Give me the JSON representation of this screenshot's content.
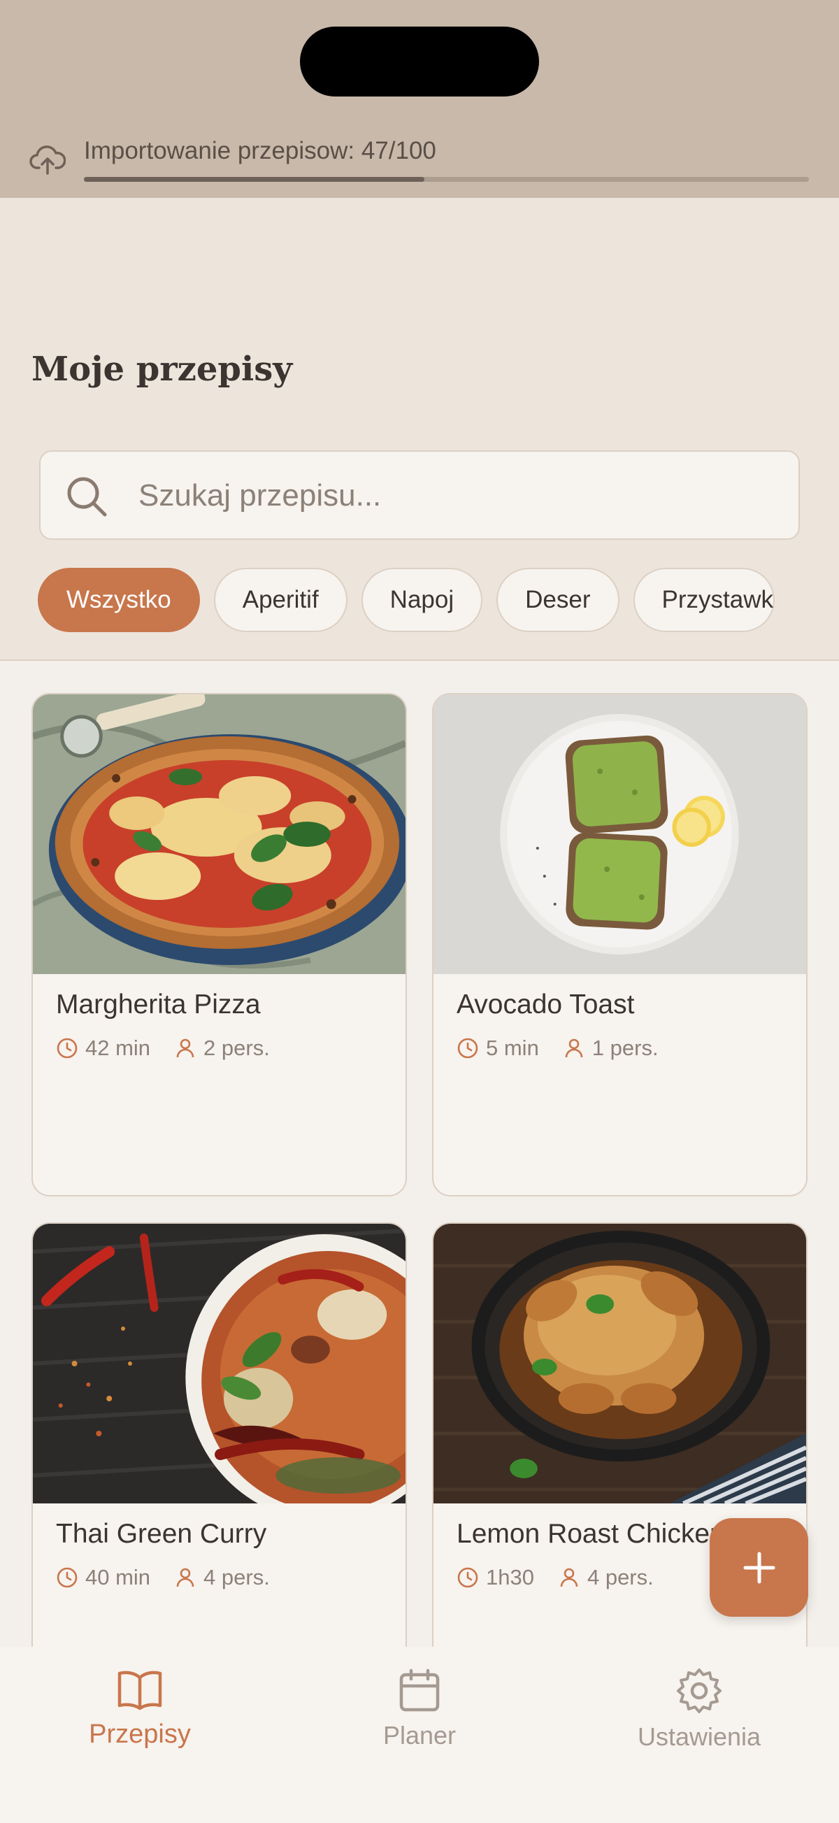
{
  "import_banner": {
    "text": "Importowanie przepisow: 47/100",
    "progress": 0.47
  },
  "page_title": "Moje przepisy",
  "search": {
    "placeholder": "Szukaj przepisu..."
  },
  "filters": [
    {
      "label": "Wszystko",
      "active": true
    },
    {
      "label": "Aperitif",
      "active": false
    },
    {
      "label": "Napoj",
      "active": false
    },
    {
      "label": "Deser",
      "active": false
    },
    {
      "label": "Przystawk",
      "active": false
    }
  ],
  "recipes": [
    {
      "title": "Margherita Pizza",
      "time": "42 min",
      "servings": "2 pers."
    },
    {
      "title": "Avocado Toast",
      "time": "5 min",
      "servings": "1 pers."
    },
    {
      "title": "Thai Green Curry",
      "time": "40 min",
      "servings": "4 pers."
    },
    {
      "title": "Lemon Roast Chicken",
      "time": "1h30",
      "servings": "4 pers."
    }
  ],
  "bottom_nav": [
    {
      "label": "Przepisy",
      "icon": "book-icon",
      "active": true
    },
    {
      "label": "Planer",
      "icon": "calendar-icon",
      "active": false
    },
    {
      "label": "Ustawienia",
      "icon": "gear-icon",
      "active": false
    }
  ],
  "colors": {
    "accent": "#c8764c",
    "background": "#ede5dc",
    "banner": "#c8b9aa",
    "text": "#3b3430",
    "muted": "#8c8178"
  }
}
